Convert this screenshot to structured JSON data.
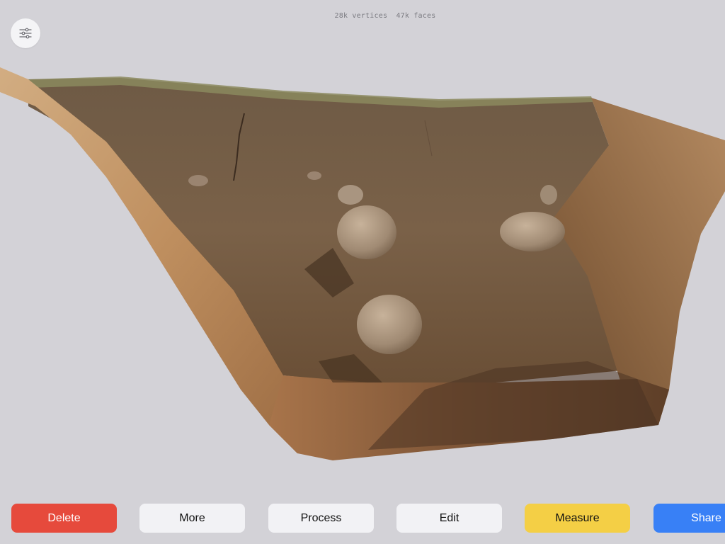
{
  "model": {
    "vertices": "28k vertices",
    "faces": "47k faces"
  },
  "toolbar": {
    "delete_label": "Delete",
    "more_label": "More",
    "process_label": "Process",
    "edit_label": "Edit",
    "measure_label": "Measure",
    "share_label": "Share"
  },
  "colors": {
    "background": "#d3d2d7",
    "delete": "#e64a3c",
    "measure": "#f4cf45",
    "share": "#3880f6",
    "neutral_button": "#f2f2f5"
  },
  "icons": {
    "settings": "sliders-icon"
  }
}
